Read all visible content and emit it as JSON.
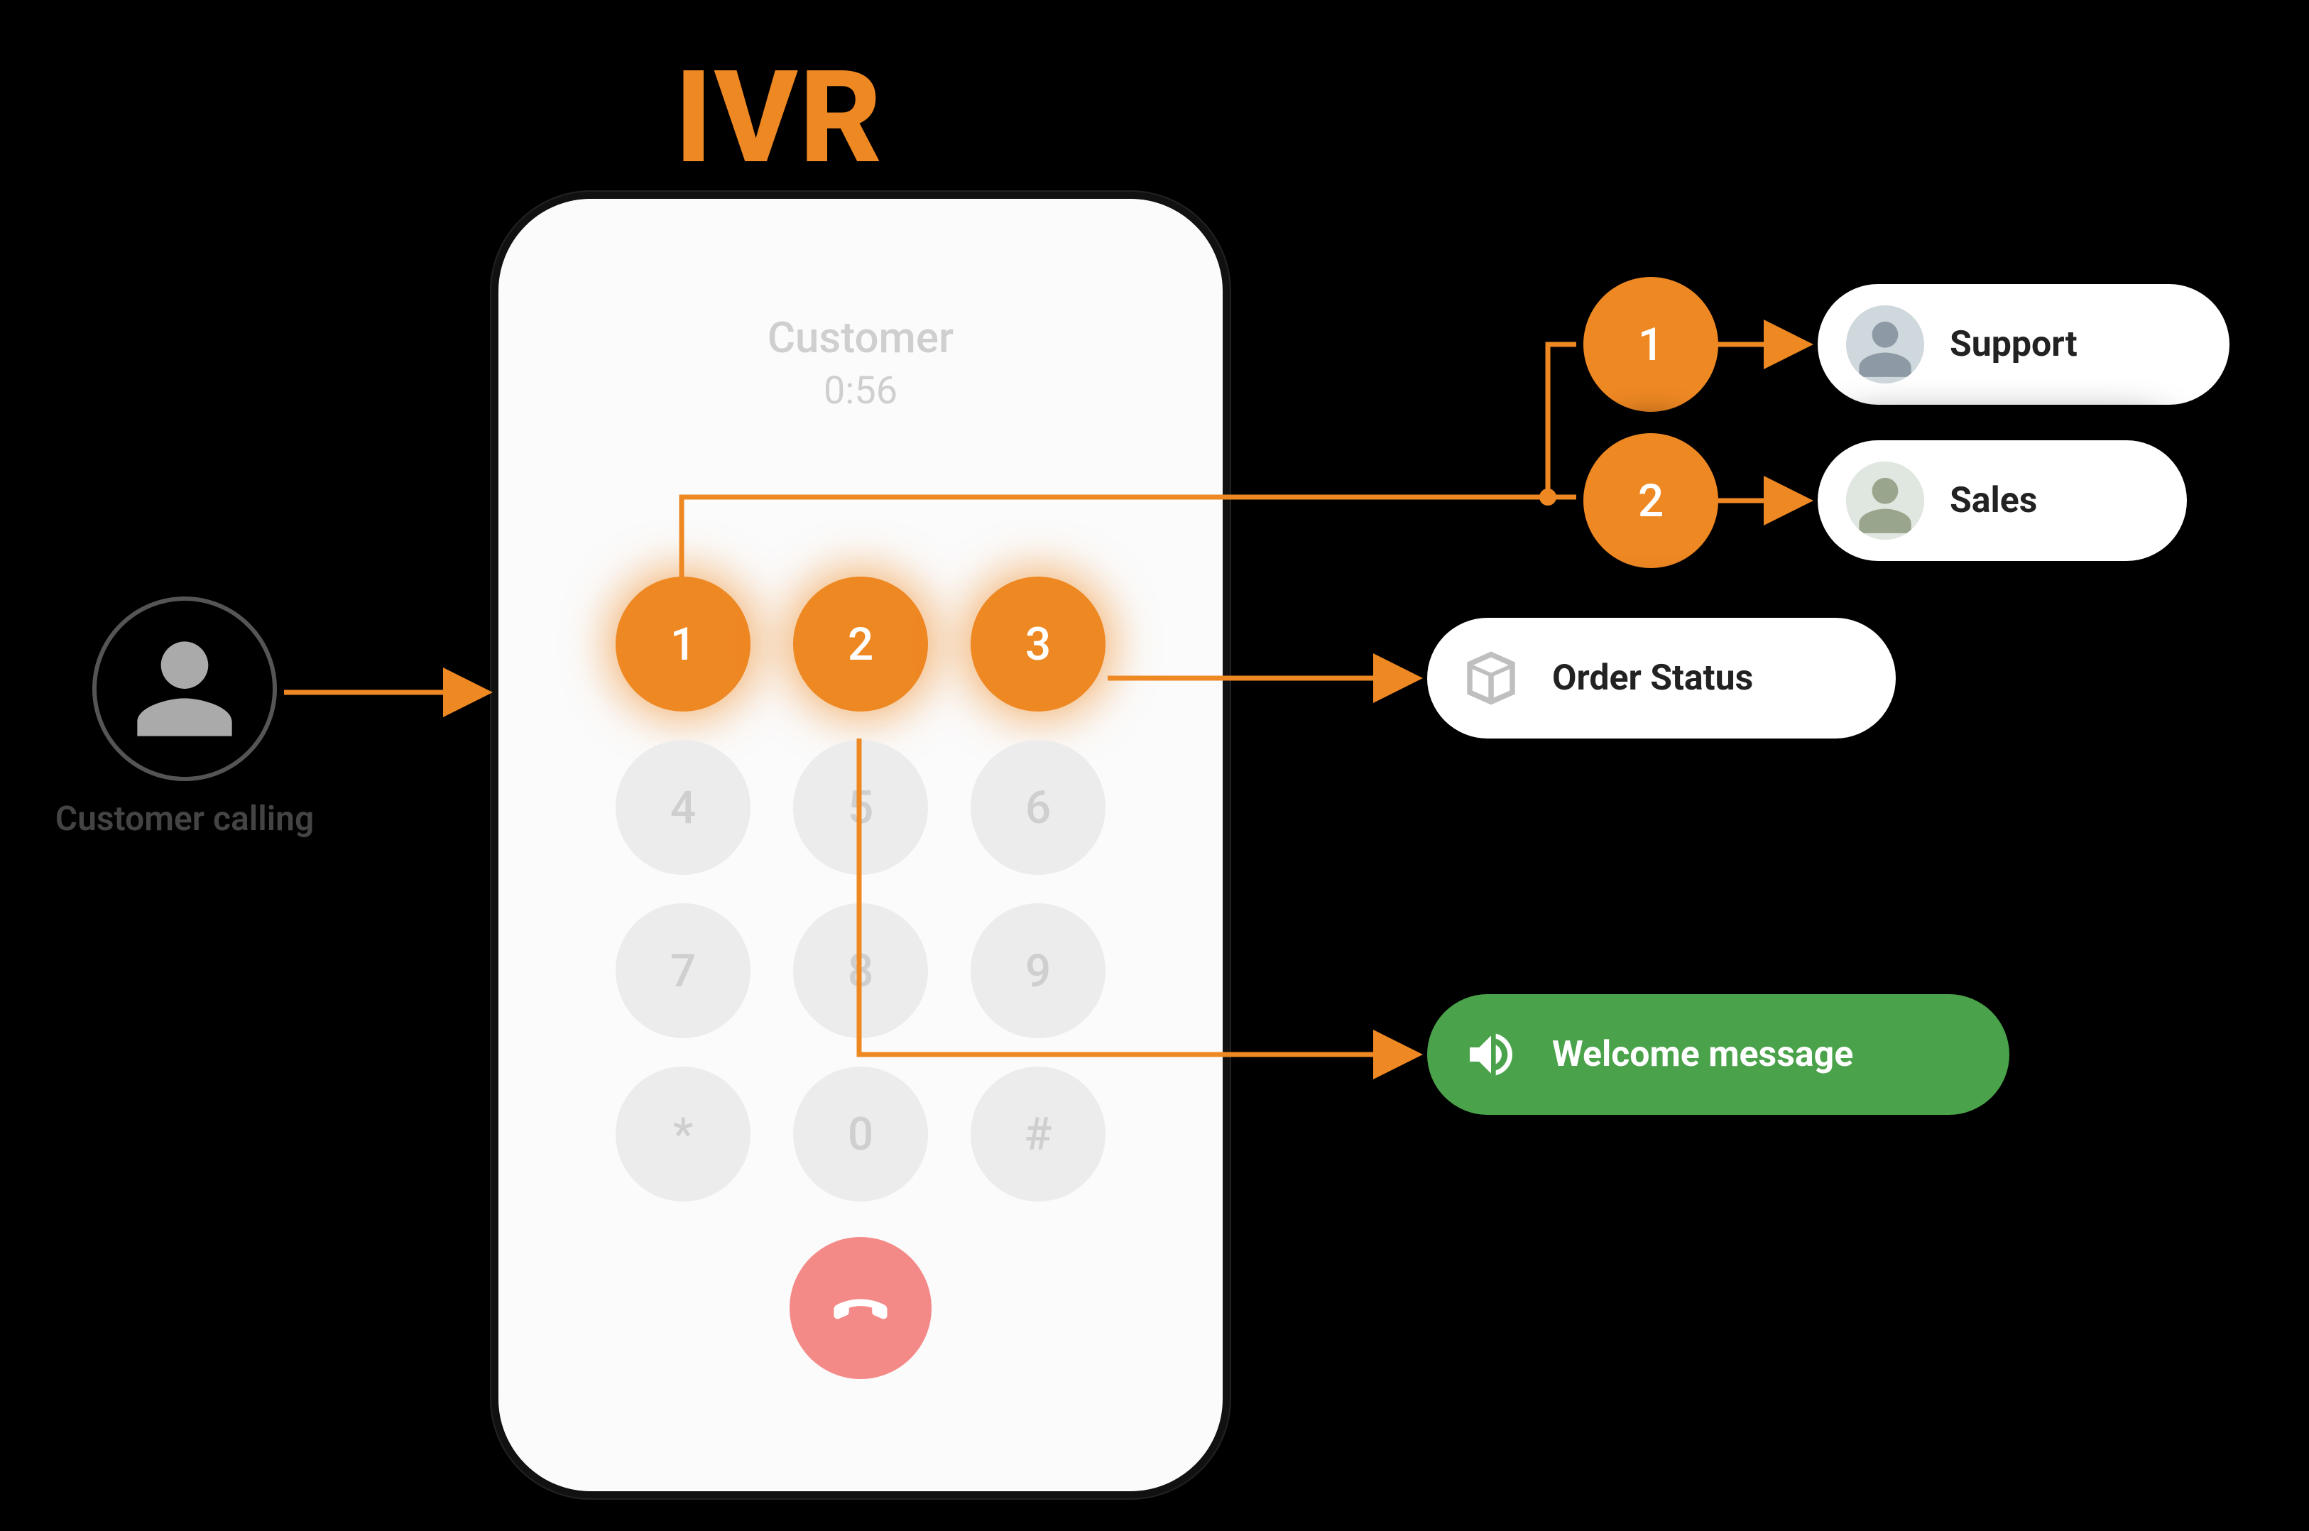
{
  "title": "IVR",
  "customer_label": "Customer calling",
  "phone": {
    "caller": "Customer",
    "duration": "0:56",
    "keys": [
      "1",
      "2",
      "3",
      "4",
      "5",
      "6",
      "7",
      "8",
      "9",
      "*",
      "0",
      "#"
    ],
    "active_keys": [
      "1",
      "2",
      "3"
    ]
  },
  "branches": {
    "sub1": "1",
    "sub2": "2"
  },
  "pills": {
    "support": "Support",
    "sales": "Sales",
    "order_status": "Order Status",
    "welcome": "Welcome message"
  },
  "colors": {
    "accent": "#ee8823",
    "green": "#4aa24a"
  }
}
